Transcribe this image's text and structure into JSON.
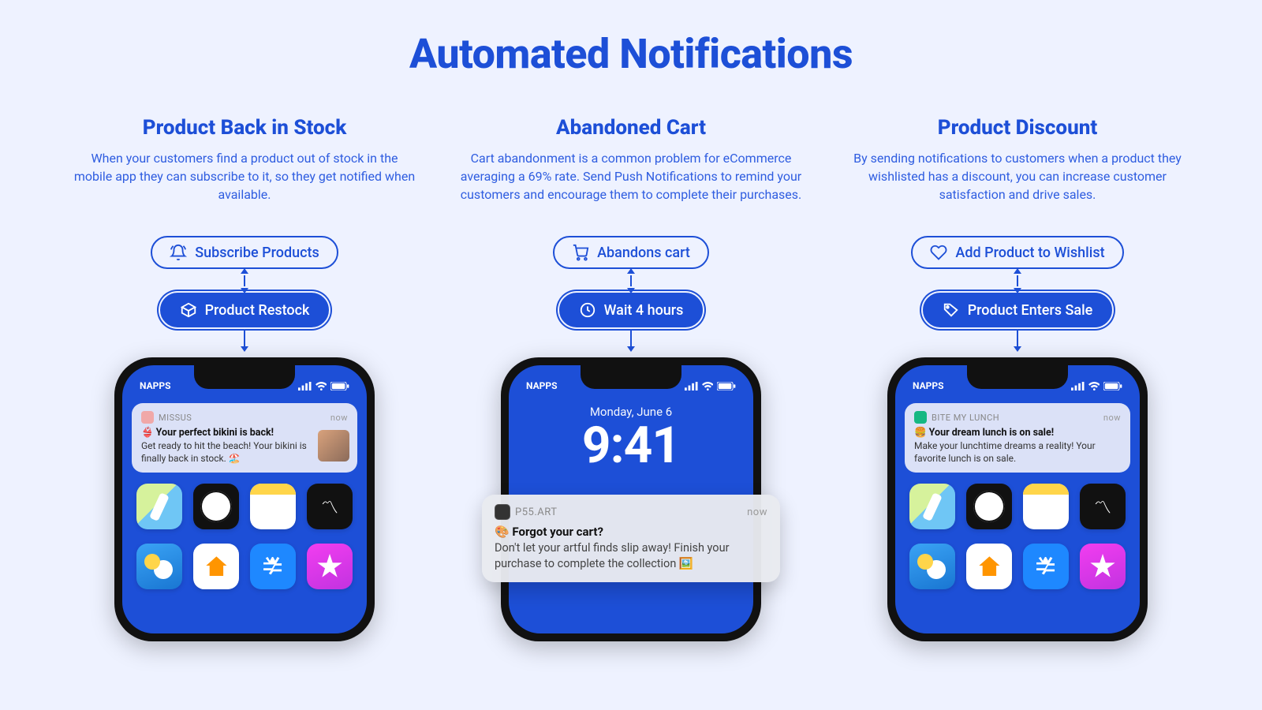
{
  "title": "Automated Notifications",
  "columns": [
    {
      "title": "Product Back in Stock",
      "desc": "When your customers find a product out of stock in the mobile app they can subscribe to it, so they get notified when available.",
      "pill1": "Subscribe Products",
      "pill2": "Product Restock",
      "phone": {
        "carrier": "NAPPS",
        "notif": {
          "app": "MISSUS",
          "time": "now",
          "title": "👙 Your perfect bikini is back!",
          "body": "Get ready to hit the beach! Your bikini is finally back in stock. 🏖️",
          "appIconColor": "#f0a8a8"
        }
      }
    },
    {
      "title": "Abandoned Cart",
      "desc": "Cart abandonment is a common problem for eCommerce averaging a 69% rate. Send Push Notifications to remind your customers and encourage them to complete their purchases.",
      "pill1": "Abandons cart",
      "pill2": "Wait 4 hours",
      "phone": {
        "carrier": "NAPPS",
        "lockDate": "Monday, June 6",
        "lockTime": "9:41",
        "notif": {
          "app": "P55.ART",
          "time": "now",
          "title": "🎨 Forgot your cart?",
          "body": "Don't let your artful finds slip away! Finish your purchase to complete the collection 🖼️"
        }
      }
    },
    {
      "title": "Product Discount",
      "desc": "By sending notifications to customers when a product they wishlisted has a discount, you can increase customer satisfaction and drive sales.",
      "pill1": "Add Product to Wishlist",
      "pill2": "Product Enters Sale",
      "phone": {
        "carrier": "NAPPS",
        "notif": {
          "app": "BITE MY LUNCH",
          "time": "now",
          "title": "🍔 Your dream lunch is on sale!",
          "body": "Make your lunchtime dreams a reality! Your favorite lunch is on sale.",
          "appIconColor": "#16b883"
        }
      }
    }
  ]
}
